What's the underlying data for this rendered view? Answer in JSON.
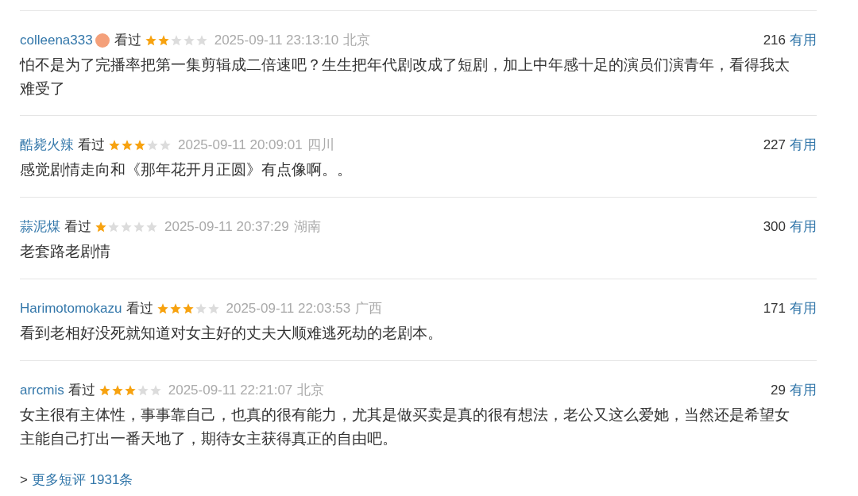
{
  "reviews": [
    {
      "user": "colleena333",
      "badge": true,
      "status": "看过",
      "stars": 2,
      "time": "2025-09-11 23:13:10",
      "location": "北京",
      "votes": "216",
      "useful": "有用",
      "text": "怕不是为了完播率把第一集剪辑成二倍速吧？生生把年代剧改成了短剧，加上中年感十足的演员们演青年，看得我太难受了"
    },
    {
      "user": "酷毙火辣",
      "badge": false,
      "status": "看过",
      "stars": 3,
      "time": "2025-09-11 20:09:01",
      "location": "四川",
      "votes": "227",
      "useful": "有用",
      "text": "感觉剧情走向和《那年花开月正圆》有点像啊。。"
    },
    {
      "user": "蒜泥煤",
      "badge": false,
      "status": "看过",
      "stars": 1,
      "time": "2025-09-11 20:37:29",
      "location": "湖南",
      "votes": "300",
      "useful": "有用",
      "text": "老套路老剧情"
    },
    {
      "user": "Harimotomokazu",
      "badge": false,
      "status": "看过",
      "stars": 3,
      "time": "2025-09-11 22:03:53",
      "location": "广西",
      "votes": "171",
      "useful": "有用",
      "text": "看到老相好没死就知道对女主好的丈夫大顺难逃死劫的老剧本。"
    },
    {
      "user": "arrcmis",
      "badge": false,
      "status": "看过",
      "stars": 3,
      "time": "2025-09-11 22:21:07",
      "location": "北京",
      "votes": "29",
      "useful": "有用",
      "text": "女主很有主体性，事事靠自己，也真的很有能力，尤其是做买卖是真的很有想法，老公又这么爱她，当然还是希望女主能自己打出一番天地了，期待女主获得真正的自由吧。"
    }
  ],
  "more": {
    "prefix": ">",
    "label": "更多短评 1931条"
  }
}
